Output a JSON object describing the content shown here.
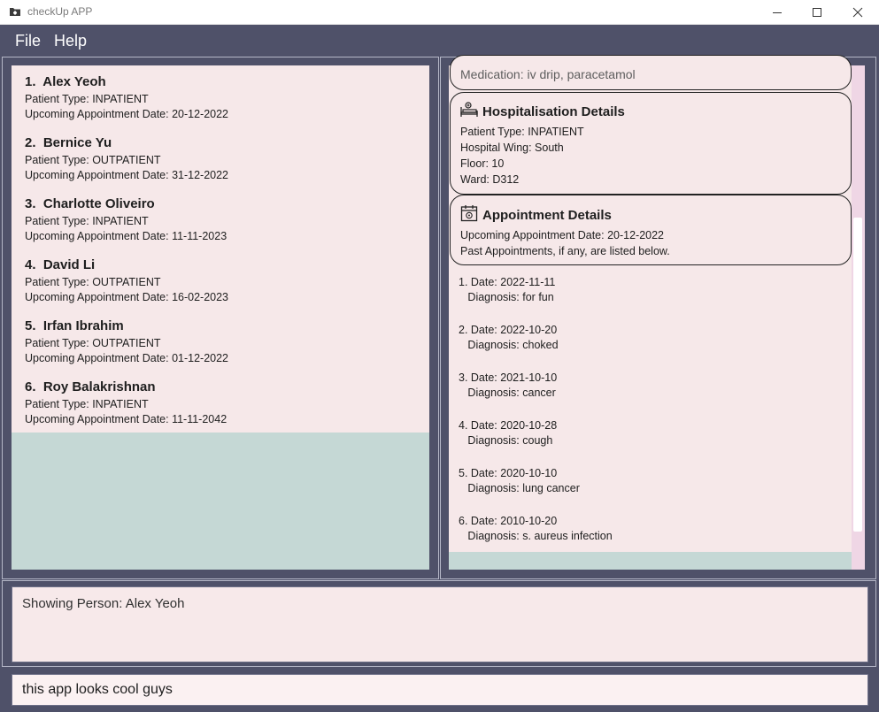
{
  "window": {
    "title": "checkUp APP"
  },
  "menu": {
    "file": "File",
    "help": "Help"
  },
  "patients": [
    {
      "name": "1.  Alex Yeoh",
      "type": "Patient Type: INPATIENT",
      "appointment": "Upcoming Appointment Date: 20-12-2022"
    },
    {
      "name": "2.  Bernice Yu",
      "type": "Patient Type: OUTPATIENT",
      "appointment": "Upcoming Appointment Date: 31-12-2022"
    },
    {
      "name": "3.  Charlotte Oliveiro",
      "type": "Patient Type: INPATIENT",
      "appointment": "Upcoming Appointment Date: 11-11-2023"
    },
    {
      "name": "4.  David Li",
      "type": "Patient Type: OUTPATIENT",
      "appointment": "Upcoming Appointment Date: 16-02-2023"
    },
    {
      "name": "5.  Irfan Ibrahim",
      "type": "Patient Type: OUTPATIENT",
      "appointment": "Upcoming Appointment Date: 01-12-2022"
    },
    {
      "name": "6.  Roy Balakrishnan",
      "type": "Patient Type: INPATIENT",
      "appointment": "Upcoming Appointment Date: 11-11-2042"
    }
  ],
  "details": {
    "medication": "Medication: iv drip, paracetamol",
    "hospitalisation": {
      "title": "Hospitalisation Details",
      "patient_type": "Patient Type: INPATIENT",
      "wing": "Hospital Wing: South",
      "floor": "Floor: 10",
      "ward": "Ward: D312"
    },
    "appointment": {
      "title": "Appointment Details",
      "upcoming": "Upcoming Appointment Date: 20-12-2022",
      "past_note": "Past Appointments, if any, are listed below."
    },
    "past_appointments": [
      {
        "date": "1. Date: 2022-11-11",
        "diagnosis": "   Diagnosis: for fun"
      },
      {
        "date": "2. Date: 2022-10-20",
        "diagnosis": "   Diagnosis: choked"
      },
      {
        "date": "3. Date: 2021-10-10",
        "diagnosis": "   Diagnosis: cancer"
      },
      {
        "date": "4. Date: 2020-10-28",
        "diagnosis": "   Diagnosis: cough"
      },
      {
        "date": "5. Date: 2020-10-10",
        "diagnosis": "   Diagnosis: lung cancer"
      },
      {
        "date": "6. Date: 2010-10-20",
        "diagnosis": "   Diagnosis: s. aureus infection"
      }
    ]
  },
  "result": {
    "text": "Showing Person: Alex Yeoh"
  },
  "command": {
    "value": "this app looks cool guys"
  }
}
